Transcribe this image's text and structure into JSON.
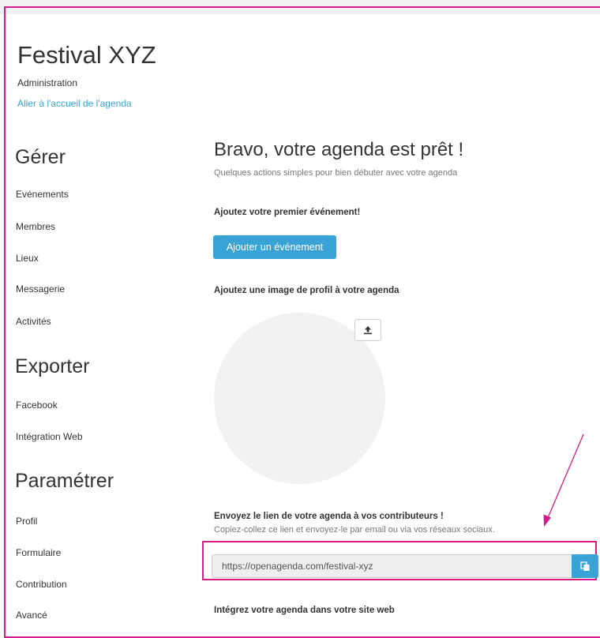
{
  "brand": {
    "title": "Festival XYZ",
    "subtitle": "Administration",
    "home_link": "Aller à l'accueil de l'agenda"
  },
  "sidebar": {
    "sections": [
      {
        "heading": "Gérer",
        "items": [
          "Evénements",
          "Membres",
          "Lieux",
          "Messagerie",
          "Activités"
        ]
      },
      {
        "heading": "Exporter",
        "items": [
          "Facebook",
          "Intégration Web"
        ]
      },
      {
        "heading": "Paramétrer",
        "items": [
          "Profil",
          "Formulaire",
          "Contribution",
          "Avancé"
        ]
      }
    ]
  },
  "main": {
    "title": "Bravo, votre agenda est prêt !",
    "subtitle": "Quelques actions simples pour bien débuter avec votre agenda",
    "first_event": {
      "heading": "Ajoutez votre premier événement!",
      "button_label": "Ajouter un événement"
    },
    "profile_image": {
      "heading": "Ajoutez une image de profil à votre agenda",
      "upload_icon": "upload-icon"
    },
    "share_link": {
      "heading": "Envoyez le lien de votre agenda à vos contributeurs !",
      "description": "Copiez-collez ce lien et envoyez-le par email ou via vos réseaux sociaux.",
      "url": "https://openagenda.com/festival-xyz",
      "copy_icon": "copy-icon"
    },
    "integrate": {
      "heading": "Intégrez votre agenda dans votre site web"
    }
  },
  "colors": {
    "accent": "#3aa3d6",
    "annotation": "#d81b8c",
    "circle": "#f1f1f1",
    "muted_text": "#777777"
  }
}
